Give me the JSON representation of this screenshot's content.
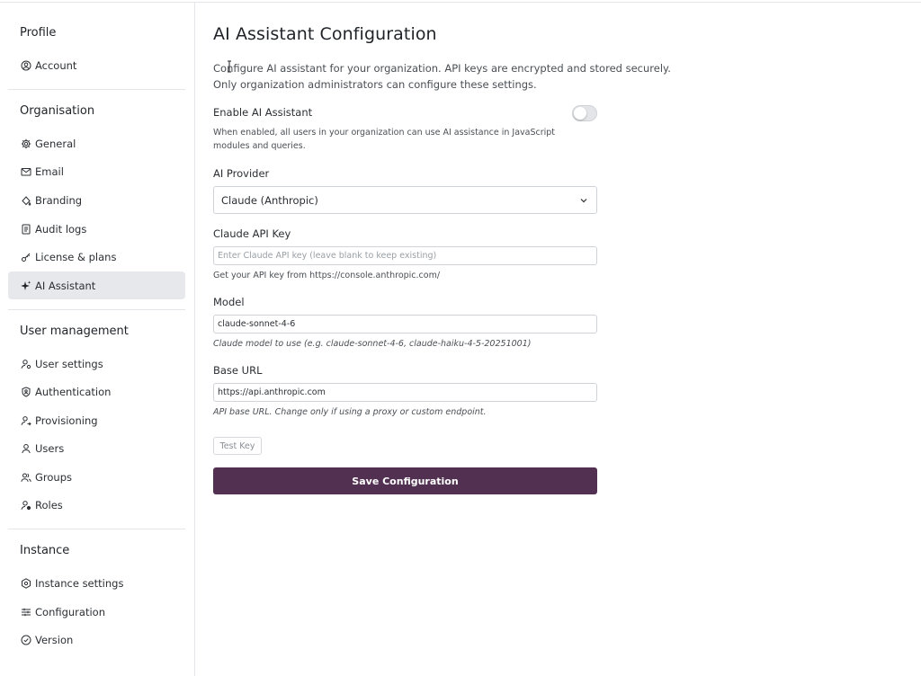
{
  "sidebar": {
    "sections": {
      "profile": {
        "title": "Profile",
        "items": [
          {
            "label": "Account",
            "icon": "user-circle-icon"
          }
        ]
      },
      "organisation": {
        "title": "Organisation",
        "items": [
          {
            "label": "General",
            "icon": "gear-icon"
          },
          {
            "label": "Email",
            "icon": "mail-icon"
          },
          {
            "label": "Branding",
            "icon": "paint-bucket-icon"
          },
          {
            "label": "Audit logs",
            "icon": "document-icon"
          },
          {
            "label": "License & plans",
            "icon": "key-icon"
          },
          {
            "label": "AI Assistant",
            "icon": "sparkle-icon",
            "active": true
          }
        ]
      },
      "user_management": {
        "title": "User management",
        "items": [
          {
            "label": "User settings",
            "icon": "user-gear-icon"
          },
          {
            "label": "Authentication",
            "icon": "shield-icon"
          },
          {
            "label": "Provisioning",
            "icon": "user-sync-icon"
          },
          {
            "label": "Users",
            "icon": "user-icon"
          },
          {
            "label": "Groups",
            "icon": "users-icon"
          },
          {
            "label": "Roles",
            "icon": "user-badge-icon"
          }
        ]
      },
      "instance": {
        "title": "Instance",
        "items": [
          {
            "label": "Instance settings",
            "icon": "hexagon-gear-icon"
          },
          {
            "label": "Configuration",
            "icon": "sliders-icon"
          },
          {
            "label": "Version",
            "icon": "clock-check-icon"
          }
        ]
      }
    }
  },
  "main": {
    "title": "AI Assistant Configuration",
    "description": "Configure AI assistant for your organization. API keys are encrypted and stored securely. Only organization administrators can configure these settings.",
    "enable": {
      "label": "Enable AI Assistant",
      "help": "When enabled, all users in your organization can use AI assistance in JavaScript modules and queries.",
      "on": false
    },
    "provider": {
      "label": "AI Provider",
      "value": "Claude (Anthropic)"
    },
    "api_key": {
      "label": "Claude API Key",
      "placeholder": "Enter Claude API key (leave blank to keep existing)",
      "value": "",
      "help": "Get your API key from https://console.anthropic.com/"
    },
    "model": {
      "label": "Model",
      "value": "claude-sonnet-4-6",
      "help": "Claude model to use (e.g. claude-sonnet-4-6, claude-haiku-4-5-20251001)"
    },
    "base_url": {
      "label": "Base URL",
      "value": "https://api.anthropic.com",
      "help": "API base URL. Change only if using a proxy or custom endpoint."
    },
    "test_button": "Test Key",
    "save_button": "Save Configuration"
  },
  "colors": {
    "accent": "#523052",
    "active_bg": "#e6e8ec",
    "border": "#cfd3d8"
  }
}
